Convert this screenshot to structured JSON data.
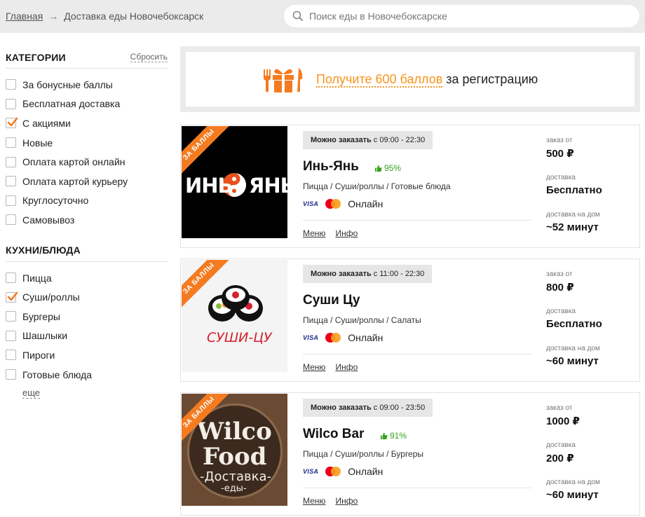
{
  "breadcrumb": {
    "home": "Главная",
    "arrow": "→",
    "current": "Доставка еды Новочебоксарск"
  },
  "search": {
    "placeholder": "Поиск еды в Новочебоксарске",
    "icon": "search-icon"
  },
  "categories": {
    "title": "КАТЕГОРИИ",
    "reset": "Сбросить",
    "items": [
      {
        "label": "За бонусные баллы",
        "checked": false
      },
      {
        "label": "Бесплатная доставка",
        "checked": false
      },
      {
        "label": "С акциями",
        "checked": true
      },
      {
        "label": "Новые",
        "checked": false
      },
      {
        "label": "Оплата картой онлайн",
        "checked": false
      },
      {
        "label": "Оплата картой курьеру",
        "checked": false
      },
      {
        "label": "Круглосуточно",
        "checked": false
      },
      {
        "label": "Самовывоз",
        "checked": false
      }
    ]
  },
  "cuisines": {
    "title": "КУХНИ/БЛЮДА",
    "items": [
      {
        "label": "Пицца",
        "checked": false
      },
      {
        "label": "Суши/роллы",
        "checked": true
      },
      {
        "label": "Бургеры",
        "checked": false
      },
      {
        "label": "Шашлыки",
        "checked": false
      },
      {
        "label": "Пироги",
        "checked": false
      },
      {
        "label": "Готовые блюда",
        "checked": false
      }
    ],
    "more": "еще"
  },
  "promo": {
    "highlight": "Получите 600 баллов",
    "rest": " за регистрацию",
    "icon": "gift-cutlery-icon"
  },
  "colors": {
    "accent": "#f47b20",
    "rating": "#3aa31f",
    "topbar": "#ebebeb"
  },
  "restaurants": [
    {
      "ribbon": "ЗА БАЛЛЫ",
      "hours_label": "Можно заказать",
      "hours": " с 09:00 - 22:30",
      "name": "Инь-Янь",
      "rating": "95%",
      "cuisine": "Пицца / Суши/роллы / Готовые блюда",
      "payment_online": "Онлайн",
      "visa": "VISA",
      "menu": "Меню",
      "info": "Инфо",
      "min_order_label": "заказ от",
      "min_order": "500 ₽",
      "delivery_label": "доставка",
      "delivery": "Бесплатно",
      "time_label": "доставка на дом",
      "time": "~52 минут",
      "logo_text_left": "ИНЬ",
      "logo_text_right": "ЯНЬ"
    },
    {
      "ribbon": "ЗА БАЛЛЫ",
      "hours_label": "Можно заказать",
      "hours": " с 11:00 - 22:30",
      "name": "Суши Цу",
      "rating": "",
      "cuisine": "Пицца / Суши/роллы / Салаты",
      "payment_online": "Онлайн",
      "visa": "VISA",
      "menu": "Меню",
      "info": "Инфо",
      "min_order_label": "заказ от",
      "min_order": "800 ₽",
      "delivery_label": "доставка",
      "delivery": "Бесплатно",
      "time_label": "доставка на дом",
      "time": "~60 минут",
      "logo_text": "СУШИ-ЦУ"
    },
    {
      "ribbon": "ЗА БАЛЛЫ",
      "hours_label": "Можно заказать",
      "hours": " с 09:00 - 23:50",
      "name": "Wilco Bar",
      "rating": "91%",
      "cuisine": "Пицца / Суши/роллы / Бургеры",
      "payment_online": "Онлайн",
      "visa": "VISA",
      "menu": "Меню",
      "info": "Инфо",
      "min_order_label": "заказ от",
      "min_order": "1000 ₽",
      "delivery_label": "доставка",
      "delivery": "200 ₽",
      "time_label": "доставка на дом",
      "time": "~60 минут",
      "logo_line1": "Wilco",
      "logo_line2": "Food",
      "logo_line3": "-Доставка-",
      "logo_line4": "-еды-"
    }
  ]
}
